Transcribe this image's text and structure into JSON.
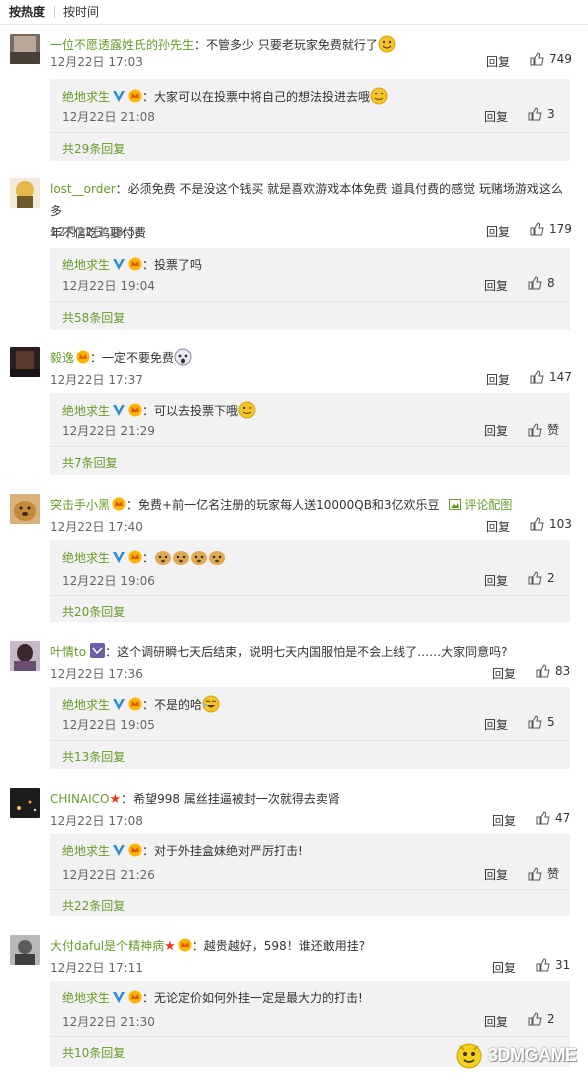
{
  "sort": {
    "hot": "按热度",
    "time": "按时间"
  },
  "colors": {
    "username": "#6a9a2a",
    "sub_bg": "#f2f2f2"
  },
  "comments": [
    {
      "name": "一位不愿透露姓氏的孙先生",
      "text": "：不管多少 只要老玩家免费就行了",
      "time": "12月22日 17:03",
      "reply": "回复",
      "likes": "749",
      "sub": {
        "name": "绝地求生",
        "text": "：大家可以在投票中将自己的想法投进去哦",
        "time": "12月22日 21:08",
        "reply": "回复",
        "likes": "3"
      },
      "more": "共29条回复"
    },
    {
      "name": "lost__order",
      "text": "：必须免费 不是没这个钱买 就是喜欢游戏本体免费 道具付费的感觉 玩赌场游戏这么多",
      "text2": "年不信吃鸡要付费",
      "time": "12月22日 18:51",
      "reply": "回复",
      "likes": "179",
      "sub": {
        "name": "绝地求生",
        "text": "：投票了吗",
        "time": "12月22日 19:04",
        "reply": "回复",
        "likes": "8"
      },
      "more": "共58条回复"
    },
    {
      "name": "毅逸",
      "text": "：一定不要免费",
      "time": "12月22日 17:37",
      "reply": "回复",
      "likes": "147",
      "sub": {
        "name": "绝地求生",
        "text": "：可以去投票下哦",
        "time": "12月22日 21:29",
        "reply": "回复",
        "likes": "赞"
      },
      "more": "共7条回复"
    },
    {
      "name": "突击手小黑",
      "text": "：免费+前一亿名注册的玩家每人送10000QB和3亿欢乐豆",
      "pic": "评论配图",
      "time": "12月22日 17:40",
      "reply": "回复",
      "likes": "103",
      "sub": {
        "name": "绝地求生",
        "text": "：",
        "time": "12月22日 19:06",
        "reply": "回复",
        "likes": "2"
      },
      "more": "共20条回复"
    },
    {
      "name": "叶情to",
      "text": "：这个调研瞬七天后结束，说明七天内国服怕是不会上线了……大家同意吗?",
      "time": "12月22日 17:36",
      "reply": "回复",
      "likes": "83",
      "sub": {
        "name": "绝地求生",
        "text": "：不是的哈",
        "time": "12月22日 19:05",
        "reply": "回复",
        "likes": "5"
      },
      "more": "共13条回复"
    },
    {
      "name": "CHINAICO",
      "text": "：希望998 属丝挂逼被封一次就得去卖肾",
      "time": "12月22日 17:08",
      "reply": "回复",
      "likes": "47",
      "sub": {
        "name": "绝地求生",
        "text": "：对于外挂盒妹绝对严厉打击!",
        "time": "12月22日 21:26",
        "reply": "回复",
        "likes": "赞"
      },
      "more": "共22条回复"
    },
    {
      "name": "大付daful是个精神病",
      "text": "：越贵越好，598！谁还敢用挂?",
      "time": "12月22日 17:11",
      "reply": "回复",
      "likes": "31",
      "sub": {
        "name": "绝地求生",
        "text": "：无论定价如何外挂一定是最大力的打击!",
        "time": "12月22日 21:30",
        "reply": "回复",
        "likes": "2"
      },
      "more": "共10条回复"
    }
  ],
  "watermark": {
    "text": "3DMGAME"
  }
}
